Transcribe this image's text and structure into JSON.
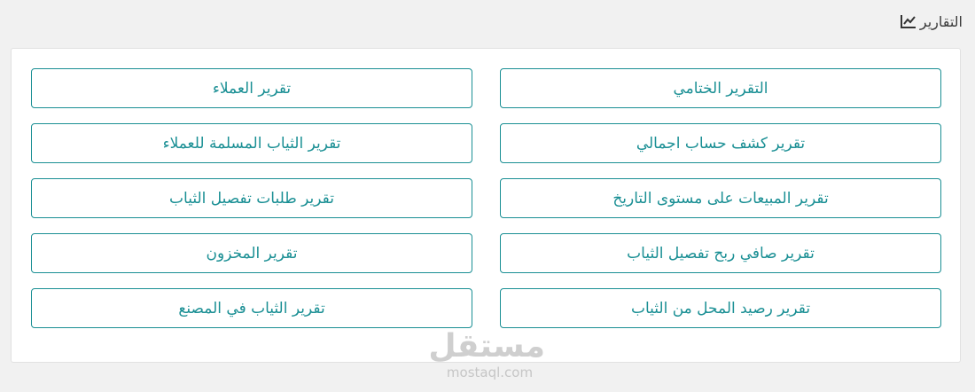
{
  "header": {
    "title": "التقارير",
    "icon": "line-chart-icon"
  },
  "reports": [
    {
      "label": "التقرير الختامي"
    },
    {
      "label": "تقرير العملاء"
    },
    {
      "label": "تقرير كشف حساب اجمالي"
    },
    {
      "label": "تقرير الثياب المسلمة للعملاء"
    },
    {
      "label": "تقرير المبيعات على مستوى التاريخ"
    },
    {
      "label": "تقرير طلبات تفصيل الثياب"
    },
    {
      "label": "تقرير صافي ربح تفصيل الثياب"
    },
    {
      "label": "تقرير المخزون"
    },
    {
      "label": "تقرير رصيد المحل من الثياب"
    },
    {
      "label": "تقرير الثياب في المصنع"
    }
  ],
  "watermark": {
    "logo_text": "مستقل",
    "url": "mostaql.com"
  },
  "colors": {
    "accent": "#1a8f94",
    "background": "#f1f1f1",
    "panel": "#ffffff"
  }
}
